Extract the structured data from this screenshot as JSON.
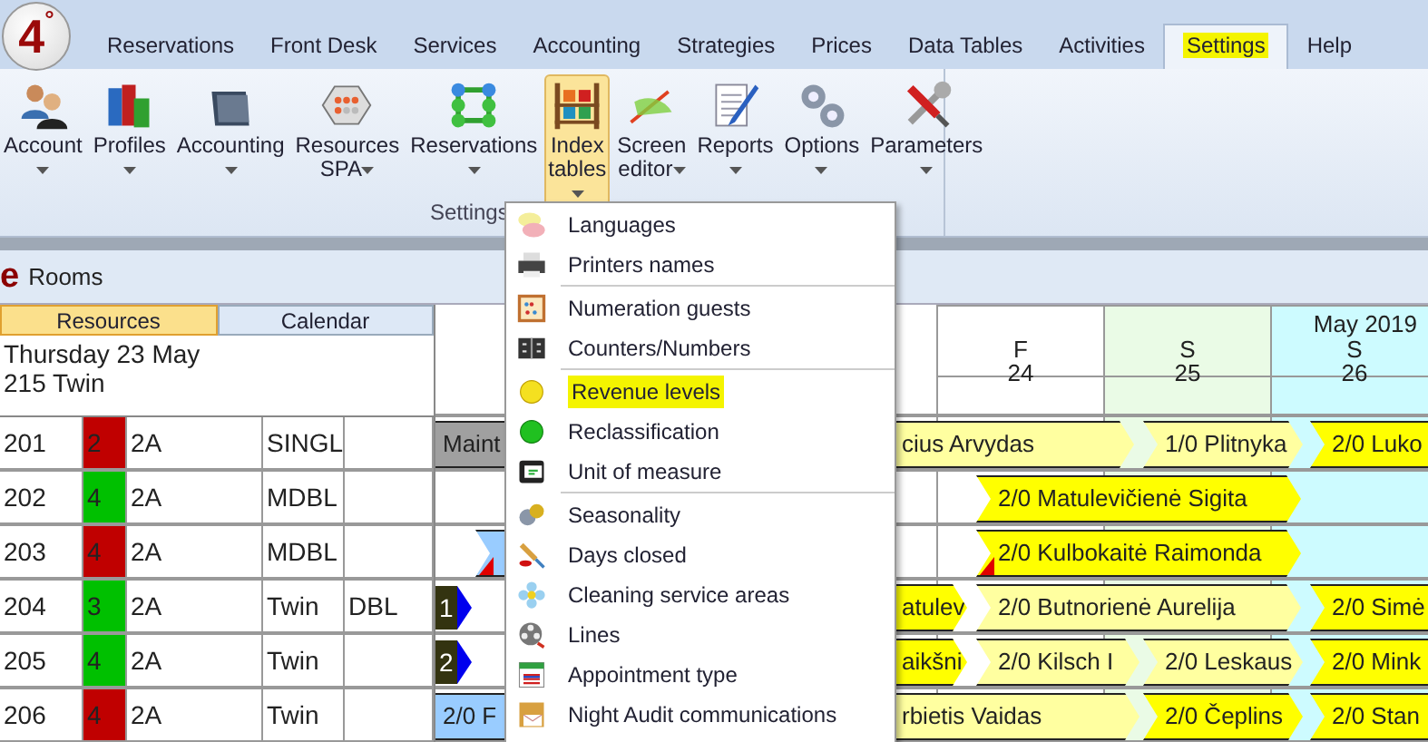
{
  "app": {
    "logo": "4$^{°}$"
  },
  "menu_tabs": [
    {
      "label": "Reservations",
      "selected": false,
      "highlighted": false
    },
    {
      "label": "Front Desk",
      "selected": false,
      "highlighted": false
    },
    {
      "label": "Services",
      "selected": false,
      "highlighted": false
    },
    {
      "label": "Accounting",
      "selected": false,
      "highlighted": false
    },
    {
      "label": "Strategies",
      "selected": false,
      "highlighted": false
    },
    {
      "label": "Prices",
      "selected": false,
      "highlighted": false
    },
    {
      "label": "Data Tables",
      "selected": false,
      "highlighted": false
    },
    {
      "label": "Activities",
      "selected": false,
      "highlighted": false
    },
    {
      "label": "Settings",
      "selected": true,
      "highlighted": true
    },
    {
      "label": "Help",
      "selected": false,
      "highlighted": false
    }
  ],
  "ribbon": {
    "group_label": "Settings",
    "buttons": [
      {
        "label": "Account",
        "selected": false
      },
      {
        "label": "Profiles",
        "selected": false
      },
      {
        "label": "Accounting",
        "selected": false
      },
      {
        "label": "Resources\nSPA",
        "selected": false
      },
      {
        "label": "Reservations",
        "selected": false
      },
      {
        "label": "Index\ntables",
        "selected": true
      },
      {
        "label": "Screen\neditor",
        "selected": false
      },
      {
        "label": "Reports",
        "selected": false
      },
      {
        "label": "Options",
        "selected": false
      },
      {
        "label": "Parameters",
        "selected": false
      }
    ]
  },
  "panel": {
    "title_mark": "e",
    "title": "Rooms",
    "view_tabs": [
      {
        "label": "Resources",
        "selected": true
      },
      {
        "label": "Calendar",
        "selected": false
      }
    ],
    "info": [
      "Thursday 23 May",
      "215 Twin"
    ]
  },
  "calendar": {
    "month": "May 2019",
    "days": [
      {
        "weekday": "F",
        "day": "24",
        "kind": "weekday"
      },
      {
        "weekday": "S",
        "day": "25",
        "kind": "saturday"
      },
      {
        "weekday": "S",
        "day": "26",
        "kind": "sunday"
      }
    ]
  },
  "rooms": [
    {
      "room": "201",
      "status": "2",
      "color": "#c00000",
      "floor": "2A",
      "type": "SINGL",
      "bookings": [
        {
          "kind": "bar",
          "text": "Maint",
          "color": "#a0a0a0",
          "flag": false
        },
        {
          "kind": "bar",
          "text": "cius Arvydas",
          "color": "#ffffa0",
          "flag": false
        },
        {
          "kind": "bar",
          "text": "1/0 Plitnyka",
          "color": "#ffffa0",
          "flag": false
        },
        {
          "kind": "bar",
          "text": "2/0 Luko",
          "color": "#ffff00",
          "flag": false
        }
      ]
    },
    {
      "room": "202",
      "status": "4",
      "color": "#00c000",
      "floor": "2A",
      "type": "MDBL",
      "bookings": [
        {
          "kind": "bar",
          "text": "2/0 Matulevičienė Sigita",
          "color": "#ffff00",
          "flag": false
        }
      ]
    },
    {
      "room": "203",
      "status": "4",
      "color": "#c00000",
      "floor": "2A",
      "type": "MDBL",
      "bookings": [
        {
          "kind": "bar",
          "color": "#99ccff",
          "flag": true
        },
        {
          "kind": "bar",
          "text": "2/0 Kulbokaitė Raimonda",
          "color": "#ffff00",
          "flag": true
        }
      ]
    },
    {
      "room": "204",
      "status": "3",
      "color": "#00c000",
      "floor": "2A",
      "type": "Twin",
      "extra": "DBL",
      "bookings": [
        {
          "kind": "marker",
          "text": "1"
        },
        {
          "kind": "bar",
          "text": "atulev",
          "color": "#ffff00",
          "flag": false
        },
        {
          "kind": "bar",
          "text": "2/0 Butnorienė Aurelija",
          "color": "#ffffa0",
          "flag": false
        },
        {
          "kind": "bar",
          "text": "2/0 Simė",
          "color": "#ffff00",
          "flag": false
        }
      ]
    },
    {
      "room": "205",
      "status": "4",
      "color": "#00c000",
      "floor": "2A",
      "type": "Twin",
      "bookings": [
        {
          "kind": "marker",
          "text": "2"
        },
        {
          "kind": "bar",
          "text": "aikšni",
          "color": "#ffff00",
          "flag": false
        },
        {
          "kind": "bar",
          "text": "2/0 Kilsch I",
          "color": "#ffffa0",
          "flag": false
        },
        {
          "kind": "bar",
          "text": "2/0 Leskaus",
          "color": "#ffffa0",
          "flag": false
        },
        {
          "kind": "bar",
          "text": "2/0 Mink",
          "color": "#ffff00",
          "flag": false
        }
      ]
    },
    {
      "room": "206",
      "status": "4",
      "color": "#c00000",
      "floor": "2A",
      "type": "Twin",
      "bookings": [
        {
          "kind": "bar",
          "text": "2/0 F",
          "color": "#99ccff",
          "flag": false
        },
        {
          "kind": "bar",
          "text": "rbietis Vaidas",
          "color": "#ffffa0",
          "flag": false
        },
        {
          "kind": "bar",
          "text": "2/0 Čeplins",
          "color": "#ffff00",
          "flag": false
        },
        {
          "kind": "bar",
          "text": "2/0 Stan",
          "color": "#ffff00",
          "flag": false
        }
      ]
    }
  ],
  "dropdown": {
    "items": [
      {
        "kind": "item",
        "label": "Languages",
        "highlighted": false
      },
      {
        "kind": "item",
        "label": "Printers names",
        "highlighted": false
      },
      {
        "kind": "separator"
      },
      {
        "kind": "item",
        "label": "Numeration guests",
        "highlighted": false
      },
      {
        "kind": "item",
        "label": "Counters/Numbers",
        "highlighted": false
      },
      {
        "kind": "separator"
      },
      {
        "kind": "item",
        "label": "Revenue levels",
        "highlighted": true
      },
      {
        "kind": "item",
        "label": "Reclassification",
        "highlighted": false
      },
      {
        "kind": "item",
        "label": "Unit of measure",
        "highlighted": false
      },
      {
        "kind": "separator"
      },
      {
        "kind": "item",
        "label": "Seasonality",
        "highlighted": false
      },
      {
        "kind": "item",
        "label": "Days closed",
        "highlighted": false
      },
      {
        "kind": "item",
        "label": "Cleaning service areas",
        "highlighted": false
      },
      {
        "kind": "item",
        "label": "Lines",
        "highlighted": false
      },
      {
        "kind": "item",
        "label": "Appointment type",
        "highlighted": false
      },
      {
        "kind": "item",
        "label": "Night Audit communications",
        "highlighted": false
      }
    ]
  }
}
